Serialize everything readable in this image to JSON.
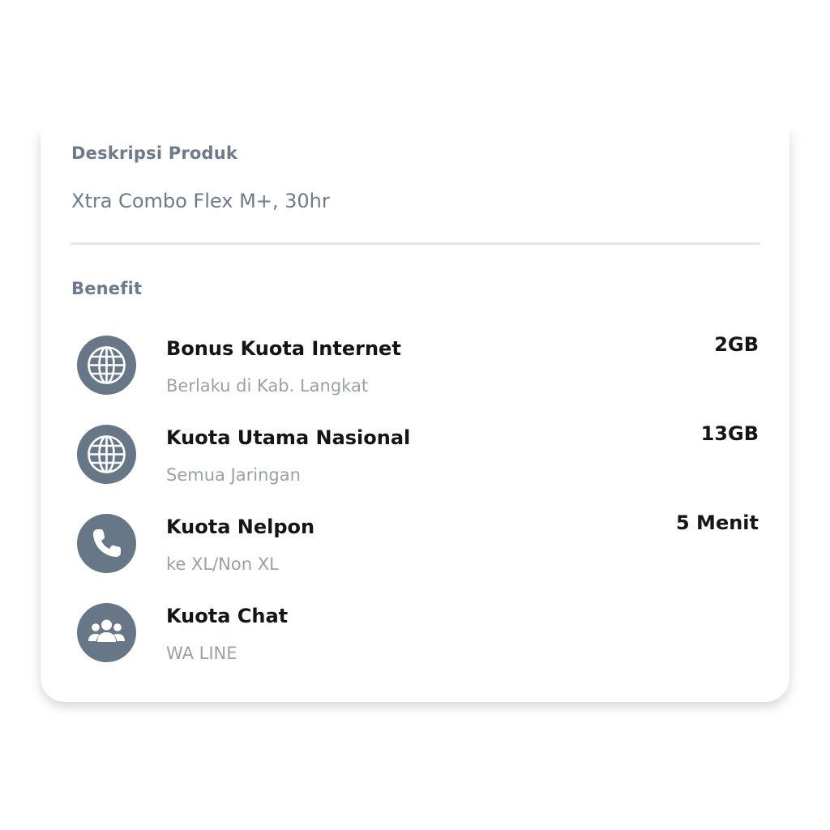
{
  "description": {
    "title": "Deskripsi Produk",
    "value": "Xtra Combo Flex M+, 30hr"
  },
  "benefit": {
    "title": "Benefit",
    "items": [
      {
        "icon": "globe-icon",
        "name": "Bonus Kuota Internet",
        "sub": "Berlaku di Kab. Langkat",
        "amount": "2GB"
      },
      {
        "icon": "globe-icon",
        "name": "Kuota Utama Nasional",
        "sub": "Semua Jaringan",
        "amount": "13GB"
      },
      {
        "icon": "phone-icon",
        "name": "Kuota Nelpon",
        "sub": "ke XL/Non XL",
        "amount": "5 Menit"
      },
      {
        "icon": "group-icon",
        "name": "Kuota Chat",
        "sub": "WA LINE",
        "amount": ""
      }
    ]
  },
  "colors": {
    "icon_background": "#687788",
    "section_title": "#6d7a8a",
    "primary_text": "#151515",
    "secondary_text": "#9aa0a8"
  }
}
